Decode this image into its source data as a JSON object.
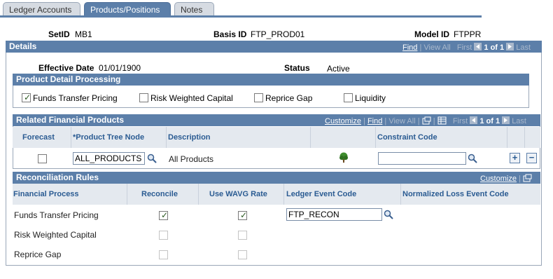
{
  "tabs": [
    {
      "label": "Ledger Accounts",
      "active": false
    },
    {
      "label": "Products/Positions",
      "active": true
    },
    {
      "label": "Notes",
      "active": false
    }
  ],
  "header": {
    "setid_label": "SetID",
    "setid_value": "MB1",
    "basis_label": "Basis ID",
    "basis_value": "FTP_PROD01",
    "model_label": "Model ID",
    "model_value": "FTPPR"
  },
  "details": {
    "title": "Details",
    "nav": {
      "find": "Find",
      "view_all": "View All",
      "first": "First",
      "count": "1 of 1",
      "last": "Last"
    },
    "effective_date_label": "Effective Date",
    "effective_date_value": "01/01/1900",
    "status_label": "Status",
    "status_value": "Active"
  },
  "product_detail": {
    "title": "Product Detail Processing",
    "options": [
      {
        "label": "Funds Transfer Pricing",
        "checked": true
      },
      {
        "label": "Risk Weighted Capital",
        "checked": false
      },
      {
        "label": "Reprice Gap",
        "checked": false
      },
      {
        "label": "Liquidity",
        "checked": false
      }
    ]
  },
  "related_products": {
    "title": "Related Financial Products",
    "nav": {
      "customize": "Customize",
      "find": "Find",
      "view_all": "View All",
      "first": "First",
      "count": "1 of 1",
      "last": "Last"
    },
    "columns": [
      "Forecast",
      "*Product Tree Node",
      "Description",
      "Constraint Code"
    ],
    "row": {
      "forecast": false,
      "tree_node": "ALL_PRODUCTS",
      "description": "All Products",
      "constraint_code": ""
    }
  },
  "reconciliation": {
    "title": "Reconciliation Rules",
    "customize": "Customize",
    "columns": [
      "Financial Process",
      "Reconcile",
      "Use WAVG Rate",
      "Ledger Event Code",
      "Normalized Loss Event Code"
    ],
    "rows": [
      {
        "process": "Funds Transfer Pricing",
        "reconcile": true,
        "wavg": true,
        "ledger_code": "FTP_RECON",
        "enabled": true
      },
      {
        "process": "Risk Weighted Capital",
        "reconcile": false,
        "wavg": false,
        "ledger_code": "",
        "enabled": false
      },
      {
        "process": "Reprice Gap",
        "reconcile": false,
        "wavg": false,
        "ledger_code": "",
        "enabled": false
      }
    ]
  },
  "colors": {
    "header_blue": "#5c7fa9",
    "col_header_bg": "#e4e9ef",
    "col_header_text": "#2a5b92"
  }
}
